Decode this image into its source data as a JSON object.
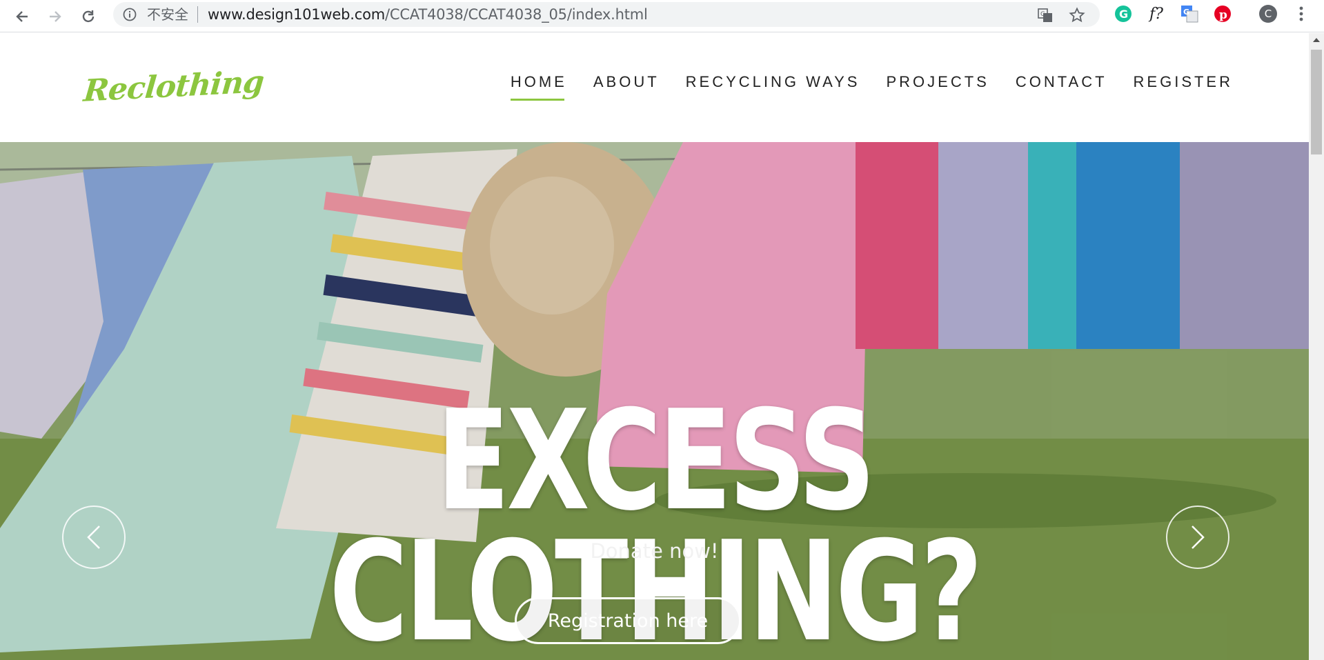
{
  "browser": {
    "security_label": "不安全",
    "url_host": "www.design101web.com",
    "url_path": "/CCAT4038/CCAT4038_05/index.html",
    "profile_initial": "C",
    "ext_f_label": "f?"
  },
  "site": {
    "logo": "Reclothing",
    "menu": [
      {
        "label": "HOME",
        "active": true
      },
      {
        "label": "ABOUT"
      },
      {
        "label": "RECYCLING WAYS"
      },
      {
        "label": "PROJECTS"
      },
      {
        "label": "CONTACT"
      },
      {
        "label": "REGISTER"
      }
    ],
    "accent_color": "#8cc63f"
  },
  "hero": {
    "title": "EXCESS CLOTHING?",
    "subtitle": "Donate now!",
    "button": "Registration here"
  }
}
